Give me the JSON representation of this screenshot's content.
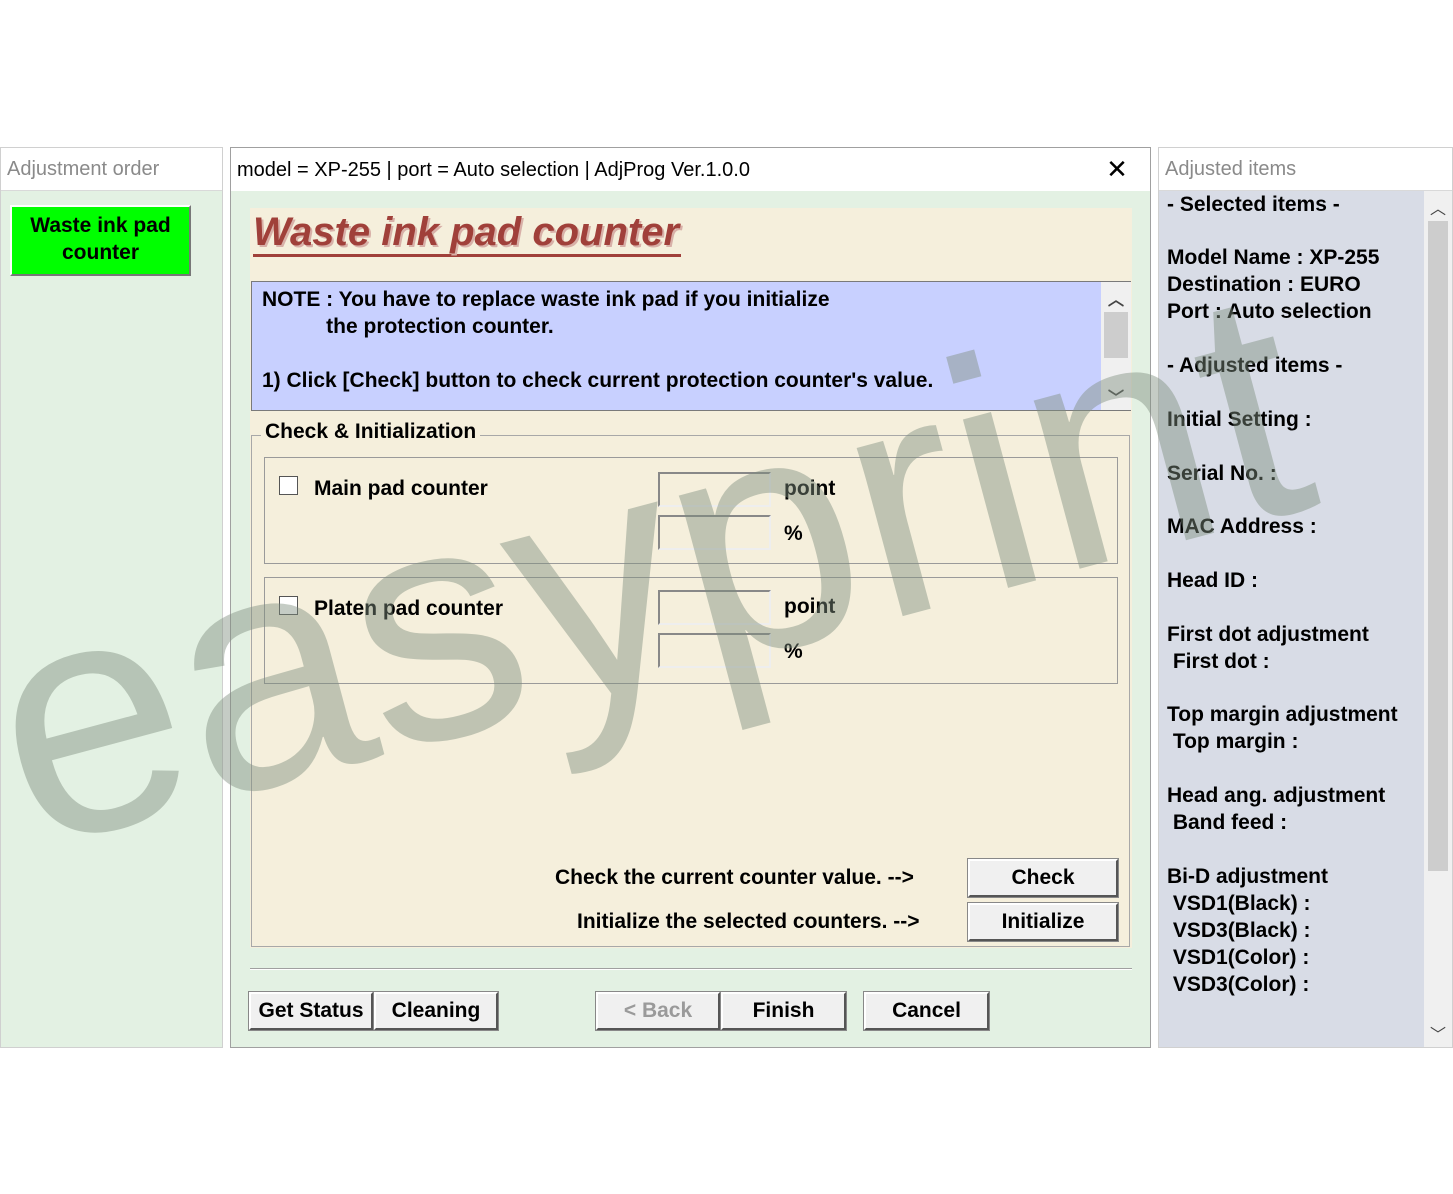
{
  "left_window": {
    "title": "Adjustment order",
    "items": [
      "Waste ink pad\ncounter"
    ]
  },
  "main_window": {
    "title": "model = XP-255 | port = Auto selection | AdjProg Ver.1.0.0",
    "close_glyph": "✕",
    "page_title": "Waste ink pad counter",
    "note_lines": [
      "NOTE : You have to replace waste ink pad if you initialize",
      "           the protection counter.",
      "1) Click [Check] button to check current protection counter's value."
    ],
    "group_label": "Check & Initialization",
    "counters": [
      {
        "label": "Main pad counter",
        "unit_point": "point",
        "unit_percent": "%"
      },
      {
        "label": "Platen pad counter",
        "unit_point": "point",
        "unit_percent": "%"
      }
    ],
    "check_prompt": "Check the current counter value. -->",
    "check_label": "Check",
    "init_prompt": "Initialize the selected counters. -->",
    "init_label": "Initialize",
    "get_status_label": "Get Status",
    "cleaning_label": "Cleaning",
    "back_label": "< Back",
    "finish_label": "Finish",
    "cancel_label": "Cancel"
  },
  "right_window": {
    "title": "Adjusted items",
    "lines": [
      "- Selected items -",
      "Model Name : XP-255",
      "Destination : EURO",
      "Port : Auto selection",
      "- Adjusted items -",
      "Initial Setting :",
      "Serial No. :",
      "MAC Address :",
      "Head ID :",
      "First dot adjustment",
      " First dot :",
      "Top margin adjustment",
      " Top margin :",
      "Head ang. adjustment",
      " Band feed :",
      "Bi-D adjustment",
      " VSD1(Black) :",
      " VSD3(Black) :",
      " VSD1(Color) :",
      " VSD3(Color) :"
    ]
  },
  "watermark": "easyprint",
  "colors": {
    "left_item_bg": "#00ff00",
    "title_red": "#a0403a",
    "note_bg": "#c8d0ff",
    "panel_bg": "#f5efdc",
    "window_bg": "#e3f1e3"
  }
}
